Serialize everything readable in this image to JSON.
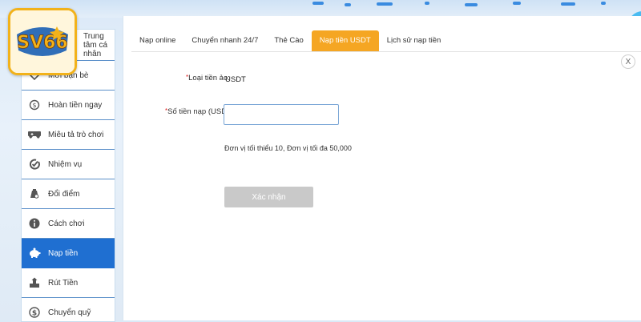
{
  "brand": {
    "logo_text": "SV66"
  },
  "sidebar": {
    "items": [
      {
        "label": "Trung tâm cá nhân",
        "icon": "user-icon",
        "active": false
      },
      {
        "label": "Mời bạn bè",
        "icon": "heart-icon",
        "active": false
      },
      {
        "label": "Hoàn tiền ngay",
        "icon": "coin-refresh-icon",
        "active": false
      },
      {
        "label": "Miêu tả trò chơi",
        "icon": "gamepad-icon",
        "active": false
      },
      {
        "label": "Nhiệm vụ",
        "icon": "task-check-icon",
        "active": false
      },
      {
        "label": "Đổi điểm",
        "icon": "points-bag-icon",
        "active": false
      },
      {
        "label": "Cách chơi",
        "icon": "info-icon",
        "active": false
      },
      {
        "label": "Nạp tiền",
        "icon": "piggy-bank-icon",
        "active": true
      },
      {
        "label": "Rút Tiền",
        "icon": "withdraw-icon",
        "active": false
      },
      {
        "label": "Chuyển quỹ",
        "icon": "dollar-circle-icon",
        "active": false
      }
    ]
  },
  "tabs": [
    {
      "label": "Nạp online",
      "active": false
    },
    {
      "label": "Chuyển nhanh 24/7",
      "active": false
    },
    {
      "label": "Thẻ Cào",
      "active": false
    },
    {
      "label": "Nạp tiền USDT",
      "active": true
    },
    {
      "label": "Lịch sử nạp tiền",
      "active": false
    }
  ],
  "form": {
    "currency_label": "Loại tiền ảo:",
    "currency_value": "USDT",
    "amount_label": "Số tiền nạp (USDT):",
    "amount_value": "",
    "required_mark": "*",
    "hint": "Đơn vị tối thiểu 10, Đơn vị tối đa 50,000",
    "submit_label": "Xác nhận"
  },
  "close_label": "X",
  "colors": {
    "active_sidebar": "#1f6fd1",
    "active_tab": "#f5a623",
    "disabled_button": "#c9c9c9",
    "required": "#e02020"
  }
}
